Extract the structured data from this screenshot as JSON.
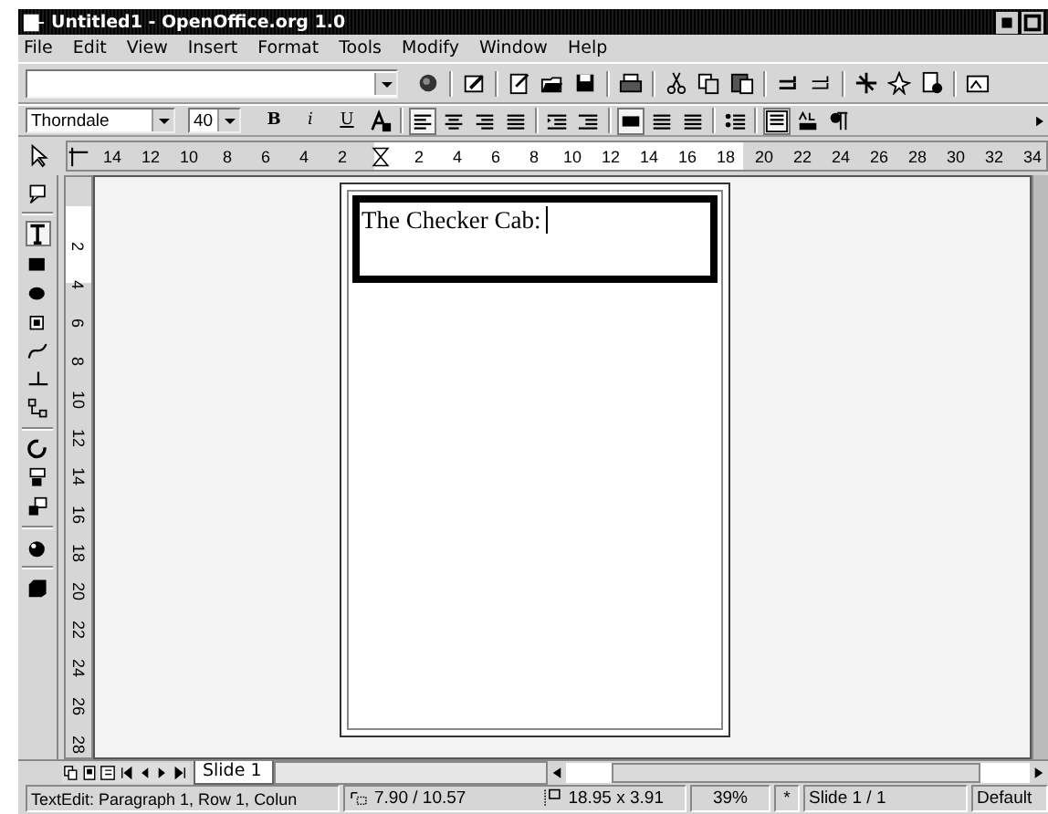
{
  "window": {
    "title": "Untitled1 - OpenOffice.org 1.0"
  },
  "menu": [
    "File",
    "Edit",
    "View",
    "Insert",
    "Format",
    "Tools",
    "Modify",
    "Window",
    "Help"
  ],
  "formatting": {
    "font_name": "Thorndale",
    "font_size": "40",
    "style_buttons": [
      "B",
      "i",
      "U"
    ],
    "alignment": [
      {
        "selected": true
      },
      {
        "selected": false
      },
      {
        "selected": false
      },
      {
        "selected": false
      }
    ],
    "line_spacing": [
      {
        "selected": true
      },
      {
        "selected": false
      },
      {
        "selected": false
      }
    ],
    "fit_text": {
      "selected": true
    }
  },
  "horizontal_ruler": {
    "left_labels": [
      "14",
      "12",
      "10",
      "8",
      "6",
      "4",
      "2"
    ],
    "right_labels": [
      "2",
      "4",
      "6",
      "8",
      "10",
      "12",
      "14",
      "16",
      "18",
      "20",
      "22",
      "24",
      "26",
      "28",
      "30",
      "32",
      "34"
    ]
  },
  "vertical_ruler": {
    "labels": [
      "2",
      "4",
      "6",
      "8",
      "10",
      "12",
      "14",
      "16",
      "18",
      "20",
      "22",
      "24",
      "26",
      "28"
    ]
  },
  "drawing_tools": [
    {
      "selected": false
    },
    {
      "selected": true
    },
    {
      "selected": false
    },
    {
      "selected": false
    },
    {
      "selected": false
    },
    {
      "selected": false
    },
    {
      "selected": false
    },
    {
      "selected": false
    },
    {
      "selected": false
    },
    {
      "selected": false
    },
    {
      "selected": false
    },
    {
      "selected": false
    },
    {
      "selected": false
    }
  ],
  "slide": {
    "text": "The Checker Cab:"
  },
  "slide_tabs": [
    {
      "label": "Slide 1",
      "selected": true
    }
  ],
  "status_bar": {
    "mode": "TextEdit: Paragraph 1, Row 1, Colun",
    "position": "7.90 / 10.57",
    "size": "18.95 x 3.91",
    "zoom": "39%",
    "modified": "*",
    "slide": "Slide 1 / 1",
    "layout": "Default"
  }
}
